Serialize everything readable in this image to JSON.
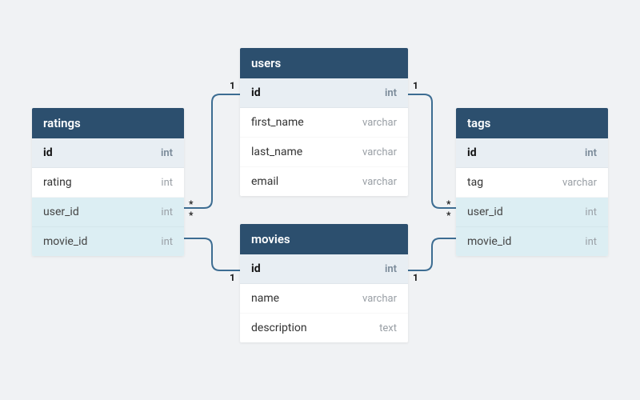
{
  "tables": {
    "ratings": {
      "title": "ratings",
      "columns": [
        {
          "name": "id",
          "type": "int",
          "pk": true
        },
        {
          "name": "rating",
          "type": "int"
        },
        {
          "name": "user_id",
          "type": "int",
          "fk": true
        },
        {
          "name": "movie_id",
          "type": "int",
          "fk": true
        }
      ]
    },
    "users": {
      "title": "users",
      "columns": [
        {
          "name": "id",
          "type": "int",
          "pk": true
        },
        {
          "name": "first_name",
          "type": "varchar"
        },
        {
          "name": "last_name",
          "type": "varchar"
        },
        {
          "name": "email",
          "type": "varchar"
        }
      ]
    },
    "movies": {
      "title": "movies",
      "columns": [
        {
          "name": "id",
          "type": "int",
          "pk": true
        },
        {
          "name": "name",
          "type": "varchar"
        },
        {
          "name": "description",
          "type": "text"
        }
      ]
    },
    "tags": {
      "title": "tags",
      "columns": [
        {
          "name": "id",
          "type": "int",
          "pk": true
        },
        {
          "name": "tag",
          "type": "varchar"
        },
        {
          "name": "user_id",
          "type": "int",
          "fk": true
        },
        {
          "name": "movie_id",
          "type": "int",
          "fk": true
        }
      ]
    }
  },
  "relationships": [
    {
      "from": "ratings.user_id",
      "to": "users.id",
      "cardinality_from": "*",
      "cardinality_to": "1"
    },
    {
      "from": "ratings.movie_id",
      "to": "movies.id",
      "cardinality_from": "*",
      "cardinality_to": "1"
    },
    {
      "from": "tags.user_id",
      "to": "users.id",
      "cardinality_from": "*",
      "cardinality_to": "1"
    },
    {
      "from": "tags.movie_id",
      "to": "movies.id",
      "cardinality_from": "*",
      "cardinality_to": "1"
    }
  ]
}
